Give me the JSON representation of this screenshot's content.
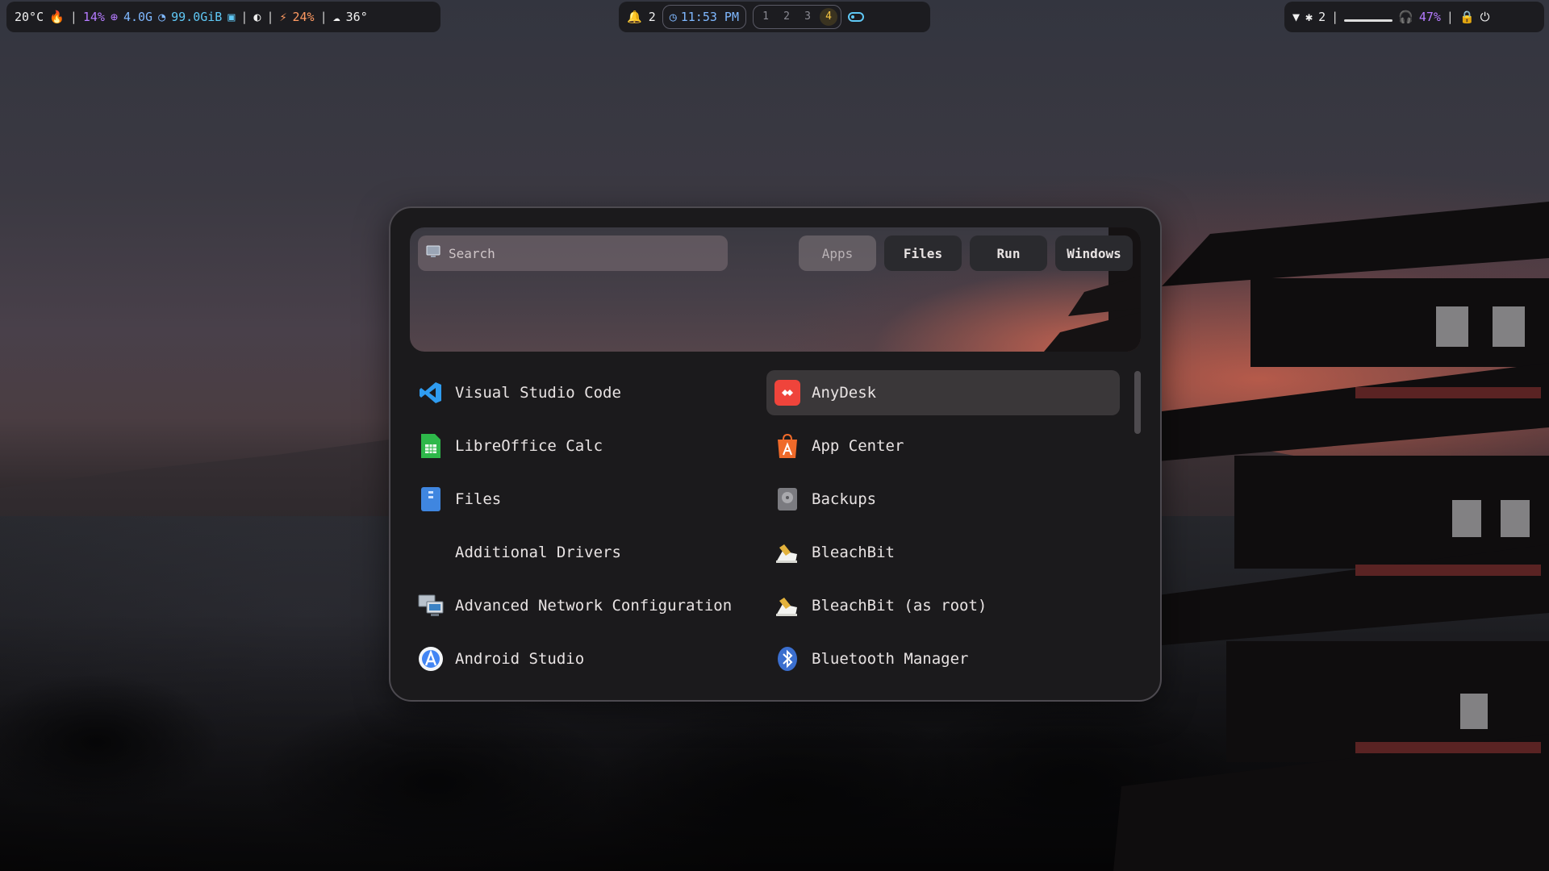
{
  "topbar": {
    "left": {
      "temperature": "20°C",
      "cpu": "14%",
      "memory": "4.0G",
      "disk": "99.0GiB",
      "power": "24%",
      "weather": "36°",
      "separator": "|"
    },
    "center": {
      "notifications": "2",
      "clock": "11:53 PM",
      "workspaces": [
        "1",
        "2",
        "3",
        "4"
      ],
      "active_workspace": "4"
    },
    "right": {
      "bluetooth_count": "2",
      "audio": "47%",
      "separator": "|",
      "media_progress": 0
    }
  },
  "launcher": {
    "search": {
      "placeholder": "Search"
    },
    "tabs": [
      {
        "label": "Apps",
        "active": true
      },
      {
        "label": "Files",
        "active": false
      },
      {
        "label": "Run",
        "active": false
      },
      {
        "label": "Windows",
        "active": false
      }
    ],
    "apps": [
      {
        "name": "Visual Studio Code",
        "icon": "vscode-icon",
        "selected": false
      },
      {
        "name": "AnyDesk",
        "icon": "anydesk-icon",
        "selected": true
      },
      {
        "name": "LibreOffice Calc",
        "icon": "libreoffice-calc-icon",
        "selected": false
      },
      {
        "name": "App Center",
        "icon": "app-center-icon",
        "selected": false
      },
      {
        "name": "Files",
        "icon": "files-icon",
        "selected": false
      },
      {
        "name": "Backups",
        "icon": "backups-icon",
        "selected": false
      },
      {
        "name": "Additional Drivers",
        "icon": "",
        "selected": false
      },
      {
        "name": "BleachBit",
        "icon": "bleachbit-icon",
        "selected": false
      },
      {
        "name": "Advanced Network Configuration",
        "icon": "network-config-icon",
        "selected": false
      },
      {
        "name": "BleachBit (as root)",
        "icon": "bleachbit-root-icon",
        "selected": false
      },
      {
        "name": "Android Studio",
        "icon": "android-studio-icon",
        "selected": false
      },
      {
        "name": "Bluetooth Manager",
        "icon": "bluetooth-icon",
        "selected": false
      }
    ]
  },
  "colors": {
    "accent_purple": "#b57bff",
    "accent_blue": "#7fb8ff",
    "accent_cyan": "#5fc8f5",
    "accent_orange": "#ff9a62",
    "active_workspace": "#f5c542",
    "anydesk_red": "#ef443b"
  }
}
